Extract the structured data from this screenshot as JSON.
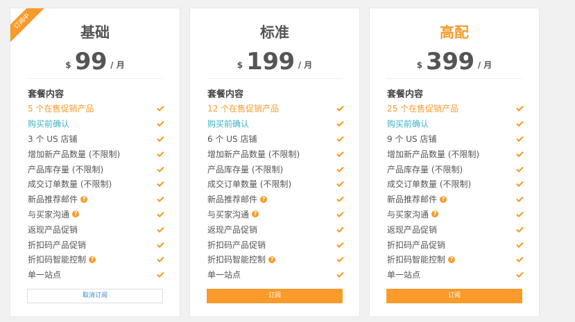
{
  "accent": "#f89b2b",
  "plans": [
    {
      "ribbon": "订阅中",
      "name": "基础",
      "currency": "$",
      "amount": "99",
      "period": "/ 月",
      "section_title": "套餐内容",
      "button": "取消订阅",
      "features": [
        "5 个在售促销产品",
        "购买前确认",
        "3 个 US 店铺",
        "增加新产品数量 (不限制)",
        "产品库存量 (不限制)",
        "成交订单数量 (不限制)",
        "新品推荐邮件",
        "与买家沟通",
        "返现产品促销",
        "折扣码产品促销",
        "折扣码智能控制",
        "单一站点"
      ]
    },
    {
      "name": "标准",
      "currency": "$",
      "amount": "199",
      "period": "/ 月",
      "section_title": "套餐内容",
      "button": "订阅",
      "features": [
        "12 个在售促销产品",
        "购买前确认",
        "6 个 US 店铺",
        "增加新产品数量 (不限制)",
        "产品库存量 (不限制)",
        "成交订单数量 (不限制)",
        "新品推荐邮件",
        "与买家沟通",
        "返现产品促销",
        "折扣码产品促销",
        "折扣码智能控制",
        "单一站点"
      ]
    },
    {
      "name": "高配",
      "currency": "$",
      "amount": "399",
      "period": "/ 月",
      "section_title": "套餐内容",
      "button": "订阅",
      "features": [
        "25 个在售促销产品",
        "购买前确认",
        "9 个 US 店铺",
        "增加新产品数量 (不限制)",
        "产品库存量 (不限制)",
        "成交订单数量 (不限制)",
        "新品推荐邮件",
        "与买家沟通",
        "返现产品促销",
        "折扣码产品促销",
        "折扣码智能控制",
        "单一站点"
      ]
    }
  ],
  "help_icon_glyph": "?"
}
